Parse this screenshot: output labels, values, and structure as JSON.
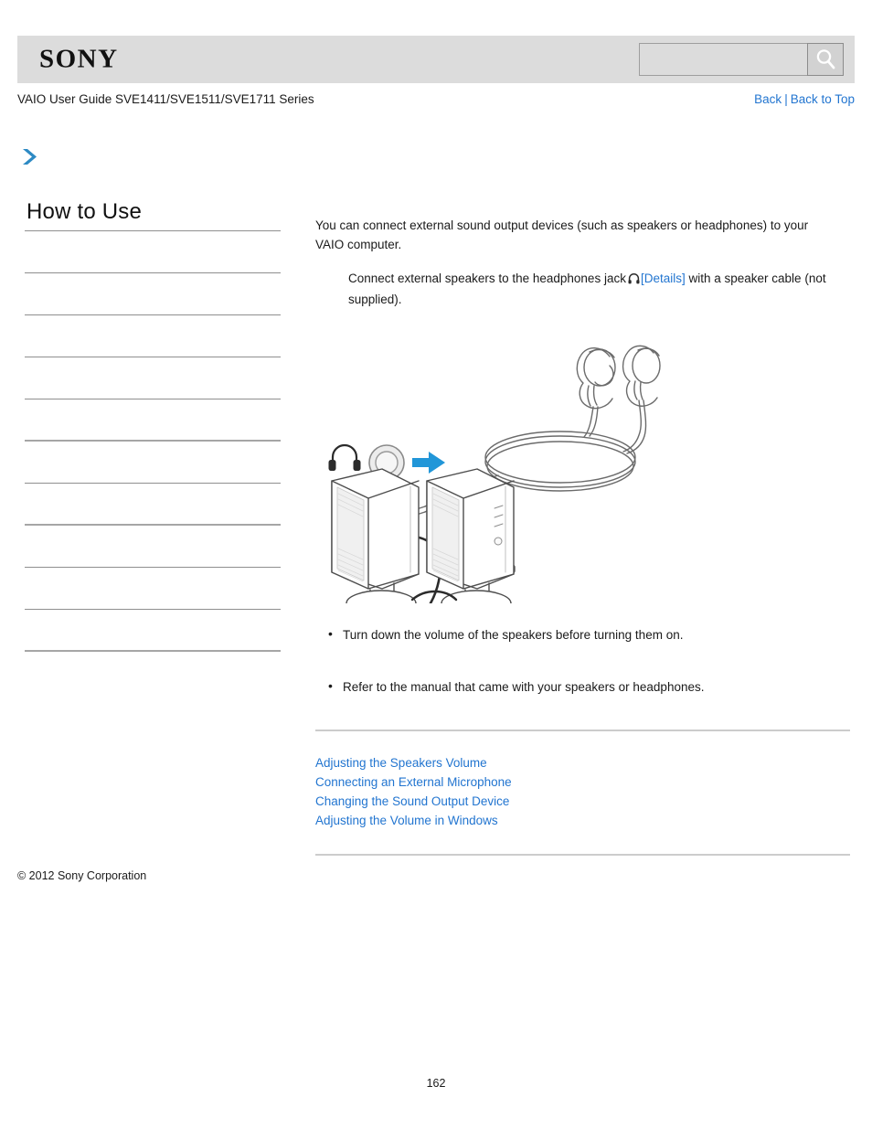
{
  "header": {
    "logo_text": "SONY",
    "search_value": "",
    "search_placeholder": "",
    "search_button_icon": "search-icon"
  },
  "subheader": {
    "guide_title": "VAIO User Guide SVE1411/SVE1511/SVE1711 Series",
    "back_label": "Back",
    "separator": "|",
    "back_to_top_label": "Back to Top"
  },
  "breadcrumb": {
    "chevron_icon": "chevron-right-icon"
  },
  "sidebar": {
    "title": "How to Use",
    "items": [
      {
        "label": ""
      },
      {
        "label": ""
      },
      {
        "label": ""
      },
      {
        "label": ""
      },
      {
        "label": ""
      },
      {
        "label": ""
      },
      {
        "label": ""
      },
      {
        "label": ""
      },
      {
        "label": ""
      },
      {
        "label": ""
      }
    ]
  },
  "main": {
    "intro": "You can connect external sound output devices (such as speakers or headphones) to your VAIO computer.",
    "step_text_before": "Connect external speakers to the headphones jack",
    "headphone_icon": "headphone-icon",
    "details_link": "[Details]",
    "step_text_after": "with a speaker cable (not supplied).",
    "illustration_alt": "Illustration showing headphones and external speakers connecting to the VAIO headphones jack",
    "notes": [
      "Turn down the volume of the speakers before turning them on.",
      "Refer to the manual that came with your speakers or headphones."
    ],
    "related_links": [
      "Adjusting the Speakers Volume",
      "Connecting an External Microphone",
      "Changing the Sound Output Device",
      "Adjusting the Volume in Windows"
    ]
  },
  "footer": {
    "copyright": "© 2012 Sony Corporation",
    "page_number": "162"
  },
  "colors": {
    "link": "#2275d0",
    "header_bg": "#dcdcdc",
    "rule": "#8f8f8f",
    "arrow_blue": "#2196d8"
  }
}
